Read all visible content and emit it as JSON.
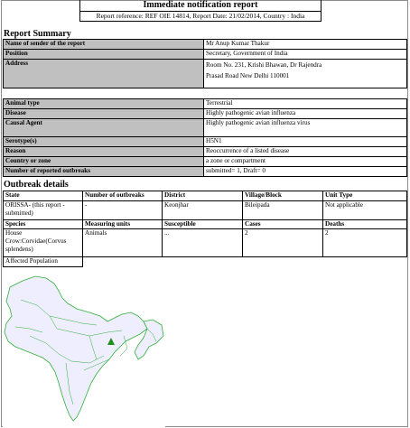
{
  "header": {
    "title": "Immediate notification report",
    "reference_line": "Report reference:   REF OIE 14814, Report Date: 21/02/2014, Country : India"
  },
  "report_summary": {
    "heading": "Report Summary",
    "rows": [
      {
        "label": "Name of sender of the report",
        "value": "Mr Anup Kumar Thakur"
      },
      {
        "label": "Position",
        "value": "Secretary, Government of India"
      },
      {
        "label": "Address",
        "value_lines": [
          "Room No. 231, Krishi Bhawan, Dr Rajendra",
          "Prasad Road New Delhi 110001"
        ]
      },
      {
        "label": "Animal type",
        "value": "Terrestrial"
      },
      {
        "label": "Disease",
        "value": "Highly pathogenic avian influenza"
      },
      {
        "label": "Causal Agent",
        "value": "Highly pathogenic avian influenza virus"
      },
      {
        "label": "Serotype(s)",
        "value": "H5N1"
      },
      {
        "label": "Reason",
        "value": "Reoccurrence of a listed disease"
      },
      {
        "label": "Country or zone",
        "value": "a zone or compartment"
      },
      {
        "label": "Number of reported outbreaks",
        "value": "submitted= 1, Draft= 0"
      }
    ]
  },
  "outbreak_details": {
    "heading": "Outbreak details",
    "header_row_1": [
      "State",
      "Number of outbreaks",
      "District",
      "Village/Block",
      "Unit Type"
    ],
    "data_row_1": [
      "ORISSA- (this report - submitted)",
      "-",
      "Keonjhar",
      "Bileipada",
      "Not applicable"
    ],
    "header_row_2": [
      "Species",
      "Measuring units",
      "Susceptible",
      "Cases",
      "Deaths"
    ],
    "data_row_2": [
      "House Crow:Corvidae(Corvus splendens)",
      "Animals",
      "...",
      "2",
      "2"
    ],
    "affected_population_label": "Affected Population"
  },
  "map": {
    "land_color": "#eeeeff",
    "border_color": "#2fae3b",
    "marker_color": "#1f8f1f",
    "marker_icon": "triangle-marker-icon"
  }
}
